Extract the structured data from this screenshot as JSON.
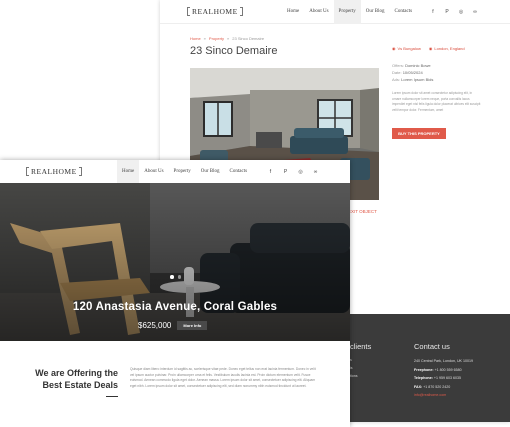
{
  "logo": {
    "text": "REALHOME"
  },
  "nav": [
    "Home",
    "About Us",
    "Property",
    "Our Blog",
    "Contacts"
  ],
  "social_icons": [
    "facebook-icon",
    "pinterest-icon",
    "instagram-icon",
    "tripadvisor-icon"
  ],
  "social_glyphs": [
    "f",
    "P",
    "◎",
    "∞"
  ],
  "detail": {
    "breadcrumb": [
      "Home",
      "Property",
      "23 Sinco Demaire"
    ],
    "title": "23 Sinco Demaire",
    "tags": [
      "Vs Bungalow",
      "London, England"
    ],
    "meta": [
      {
        "k": "Offers:",
        "v": "Dominic Bowe"
      },
      {
        "k": "Date:",
        "v": "10/05/2024"
      },
      {
        "k": "Ads:",
        "v": "Lorem Ipsum Bids"
      }
    ],
    "description": "Lorem ipsum dolor sit amet consectetur adipiscing elit, in ornare nullamcorper lorem neque, porta convallis lacus imperdiet eget nisl felis ligula dolor placerat ultrices elit suscipit velit tempor dolor. Fermentum, amet",
    "buy_label": "BUY THIS PROPERTY",
    "export_label": "EXIT OBJECT"
  },
  "footer": {
    "clients_title": "clients",
    "clients_items": [
      "s",
      "is",
      "tions"
    ],
    "contact_title": "Contact us",
    "contact_address": "240 Central Park, London, UK 10019",
    "contact_rows": [
      {
        "k": "Freephone:",
        "v": "+1 800 559 6580"
      },
      {
        "k": "Telephone:",
        "v": "+1 959 603 6035"
      },
      {
        "k": "FAX:",
        "v": "+1 870 520 2420"
      }
    ],
    "contact_email": "info@realhome.com"
  },
  "home": {
    "hero_address": "120 Anastasia Avenue, Coral Gables",
    "hero_price": "$625,000",
    "more_label": "More Info",
    "offer_title": "We are Offering the Best Estate Deals",
    "offer_text": "Quisque diam libero interdum id sagittis ac, scelerisque vitae pede. Donec eget tellus non erat lacinia fermentum. Donec in velit vel ipsum auctor pulvinar. Proin ullamcorper urna et felis. Vestibulum iaculis lacinia est. Proin dictum elementum velit. Fusce euismod. Aenean commodo ligula eget dolor. Aenean massa. Lorem ipsum dolor sit amet, consectetuer adipiscing elit. Aliquam eget nibh. Lorem ipsum dolor sit amet, consectetuer adipiscing elit, sed diam nonummy nibh euismod tincidunt ut laoreet."
  },
  "colors": {
    "accent": "#e05a4a",
    "footer_bg": "#3b3b3b"
  }
}
